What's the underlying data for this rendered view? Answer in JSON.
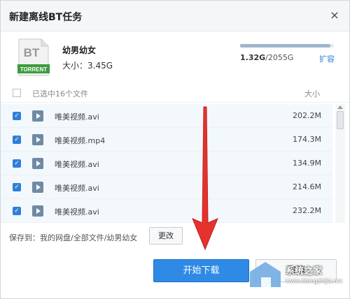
{
  "dialog": {
    "title": "新建离线BT任务",
    "close_glyph": "×"
  },
  "task": {
    "icon_text": "BT",
    "icon_label": "TORRENT",
    "name": "幼男幼女",
    "size": "大小：3.45G"
  },
  "quota": {
    "used": "1.32G",
    "total": "/2055G",
    "fraction": 0.96,
    "expand": "扩容"
  },
  "list": {
    "selected_summary": "已选中16个文件",
    "size_header": "大小",
    "files": [
      {
        "name": "唯美视频.avi",
        "size": "202.2M",
        "checked": true
      },
      {
        "name": "唯美视频.mp4",
        "size": "174.3M",
        "checked": true
      },
      {
        "name": "唯美视频.avi",
        "size": "134.9M",
        "checked": true
      },
      {
        "name": "唯美视频.avi",
        "size": "214.6M",
        "checked": true
      },
      {
        "name": "唯美视频.avi",
        "size": "232.2M",
        "checked": true
      }
    ]
  },
  "save": {
    "label": "保存到：我的网盘/全部文件/幼男幼女",
    "change": "更改"
  },
  "actions": {
    "start": "开始下载",
    "cancel": "取消"
  },
  "watermark": {
    "text": "系统之家",
    "url": "www.xitongzhijia.net"
  },
  "colors": {
    "accent": "#2f8ae6",
    "arrow": "#e5322d",
    "torrent_green": "#3d9a3d"
  }
}
